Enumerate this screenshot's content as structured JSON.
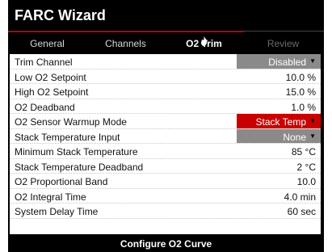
{
  "app": {
    "title": "FARC Wizard"
  },
  "tabs": [
    {
      "label": "General",
      "state": "normal"
    },
    {
      "label": "Channels",
      "state": "normal"
    },
    {
      "label": "O2 Trim",
      "state": "active"
    },
    {
      "label": "Review",
      "state": "disabled"
    }
  ],
  "rows": [
    {
      "label": "Trim Channel",
      "value": "Disabled",
      "type": "select",
      "color": "#8a8a8a"
    },
    {
      "label": "Low O2 Setpoint",
      "value": "10.0 %",
      "type": "text"
    },
    {
      "label": "High O2 Setpoint",
      "value": "15.0 %",
      "type": "text"
    },
    {
      "label": "O2 Deadband",
      "value": "1.0 %",
      "type": "text"
    },
    {
      "label": "O2 Sensor Warmup Mode",
      "value": "Stack Temp",
      "type": "select",
      "color": "#c80000"
    },
    {
      "label": "Stack Temperature Input",
      "value": "None",
      "type": "select",
      "color": "#8a8a8a"
    },
    {
      "label": "Minimum Stack Temperature",
      "value": "85 °C",
      "type": "text"
    },
    {
      "label": "Stack Temperature Deadband",
      "value": "2 °C",
      "type": "text"
    },
    {
      "label": "O2 Proportional Band",
      "value": "10.0",
      "type": "text"
    },
    {
      "label": "O2 Integral Time",
      "value": "4.0 min",
      "type": "text"
    },
    {
      "label": "System Delay Time",
      "value": "60 sec",
      "type": "text"
    }
  ],
  "footer": {
    "button_label": "Configure O2 Curve"
  },
  "icons": {
    "active_tab_marker": "flame-icon",
    "dropdown": "caret-down-icon"
  },
  "colors": {
    "accent": "#c00000",
    "select_gray": "#8a8a8a",
    "select_red": "#c80000"
  }
}
